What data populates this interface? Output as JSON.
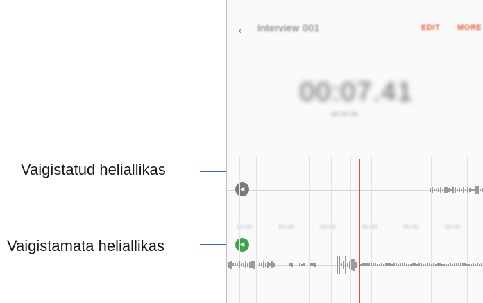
{
  "callouts": {
    "muted_label": "Vaigistatud heliallikas",
    "unmuted_label": "Vaigistamata heliallikas"
  },
  "appbar": {
    "title": "Interview 001",
    "edit_label": "EDIT",
    "more_label": "MORE"
  },
  "recording": {
    "time": "00:07.41",
    "subtext": "00:00:00"
  },
  "timeline": {
    "ticks": [
      "00:00",
      "00:00",
      "00:00",
      "00:00",
      "00:00",
      "00:00"
    ]
  },
  "icons": {
    "back": "arrow-left-icon",
    "muted": "speaker-muted-icon",
    "unmuted": "speaker-on-icon"
  },
  "colors": {
    "accent": "#e45a2c",
    "playhead": "#e24b3b",
    "unmuted_badge": "#3fa34d",
    "muted_badge": "#7a7a7a"
  }
}
